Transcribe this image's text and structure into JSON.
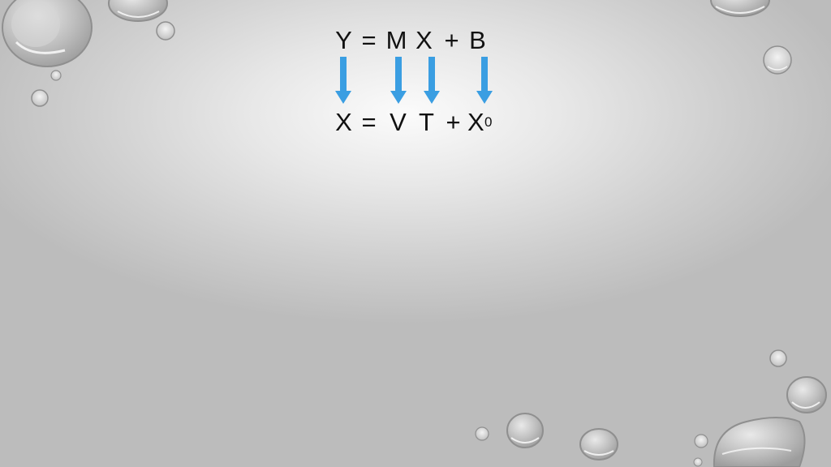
{
  "slide": {
    "equation_general": [
      "Y",
      "=",
      "M",
      "X",
      "+",
      "B"
    ],
    "equation_motion": {
      "tokens": [
        "X",
        "=",
        "V",
        "T",
        "+",
        "X"
      ],
      "subscript": "0"
    },
    "arrow_color": "#3a9ee2",
    "arrows": [
      "M to V",
      "X to T",
      "B to X0"
    ]
  }
}
